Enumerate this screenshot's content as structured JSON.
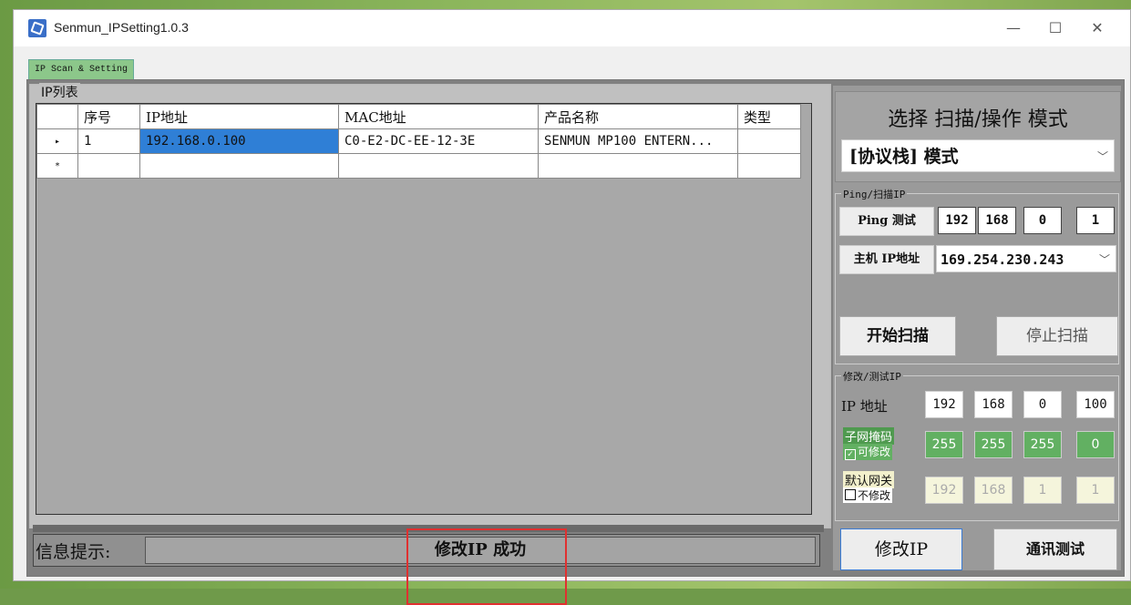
{
  "window": {
    "title": "Senmun_IPSetting1.0.3",
    "controls": {
      "minimize": "—",
      "maximize": "☐",
      "close": "✕"
    }
  },
  "tab": {
    "label": "IP Scan & Setting"
  },
  "ip_list": {
    "group_label": "IP列表",
    "columns": [
      "序号",
      "IP地址",
      "MAC地址",
      "产品名称",
      "类型"
    ],
    "rows": [
      {
        "indicator": "▸",
        "cells": [
          "1",
          "192.168.0.100",
          "C0-E2-DC-EE-12-3E",
          "SENMUN MP100 ENTERN...",
          ""
        ]
      },
      {
        "indicator": "*",
        "cells": [
          "",
          "",
          "",
          "",
          ""
        ]
      }
    ]
  },
  "status": {
    "label": "信息提示:",
    "message": "修改IP 成功"
  },
  "mode": {
    "title": "选择 扫描/操作 模式",
    "selected": "[协议栈]  模式"
  },
  "ping_scan": {
    "legend": "Ping/扫描IP",
    "ping_label": "Ping 测试",
    "ping_ip": [
      "192",
      "168",
      "0",
      "1"
    ],
    "host_label": "主机 IP地址",
    "host_ip": "169.254.230.243",
    "start_button": "开始扫描",
    "stop_button": "停止扫描"
  },
  "modify": {
    "legend": "修改/测试IP",
    "ip_label": "IP 地址",
    "ip": [
      "192",
      "168",
      "0",
      "100"
    ],
    "subnet_label": "子网掩码",
    "subnet_check": "可修改",
    "subnet": [
      "255",
      "255",
      "255",
      "0"
    ],
    "gateway_label": "默认网关",
    "gateway_check": "不修改",
    "gateway": [
      "192",
      "168",
      "1",
      "1"
    ],
    "modify_button": "修改IP",
    "test_button": "通讯测试"
  }
}
